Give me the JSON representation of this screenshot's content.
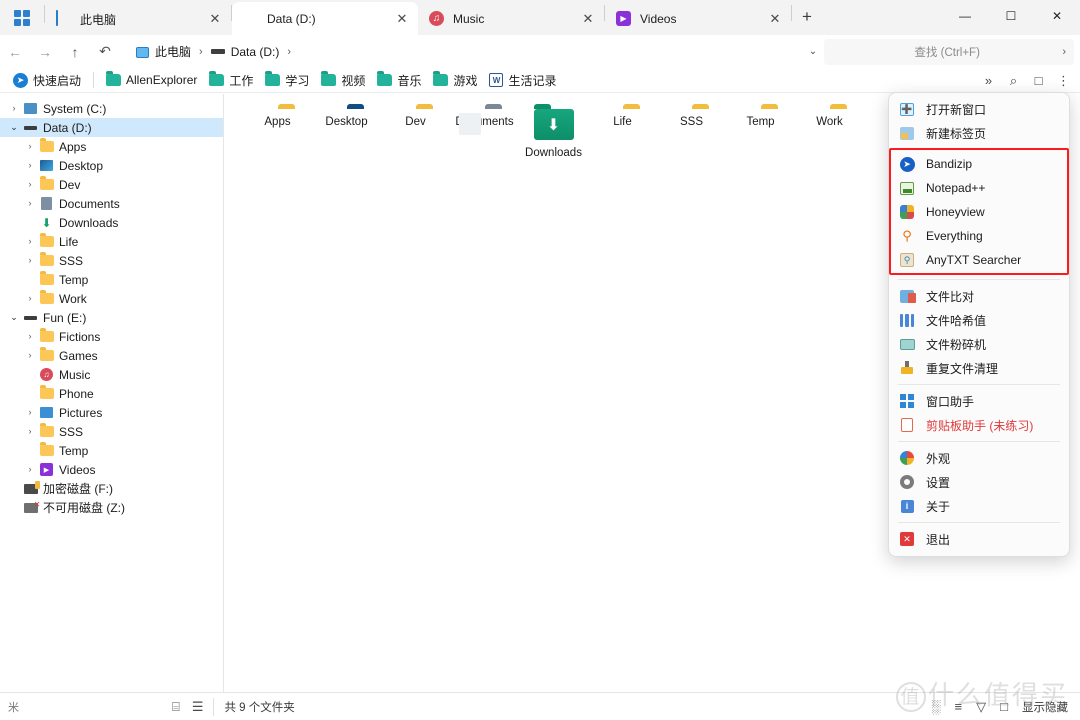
{
  "window": {
    "apps_button": "apps-grid",
    "minimize": "—",
    "maximize": "☐",
    "close": "✕",
    "new_tab": "+"
  },
  "tabs": [
    {
      "label": "此电脑",
      "icon": "monitor-icon",
      "active": false,
      "close": "✕"
    },
    {
      "label": "Data (D:)",
      "icon": "drive-icon",
      "active": true,
      "close": "✕"
    },
    {
      "label": "Music",
      "icon": "music-icon",
      "active": false,
      "close": "✕"
    },
    {
      "label": "Videos",
      "icon": "video-icon",
      "active": false,
      "close": "✕"
    }
  ],
  "addressbar": {
    "back": "←",
    "forward": "→",
    "up": "↑",
    "recent": "↶",
    "crumbs": [
      {
        "label": "此电脑",
        "icon": "monitor-icon"
      },
      {
        "label": "Data (D:)",
        "icon": "drive-icon"
      }
    ],
    "separator": "›",
    "dropdown_caret": "⌄",
    "search_placeholder": "查找 (Ctrl+F)",
    "search_value": "",
    "search_arrow": "›"
  },
  "bookmarks": {
    "quick_launch_label": "快速启动",
    "items": [
      {
        "label": "AllenExplorer",
        "icon": "folder-green-icon"
      },
      {
        "label": "工作",
        "icon": "folder-green-icon"
      },
      {
        "label": "学习",
        "icon": "folder-green-icon"
      },
      {
        "label": "视频",
        "icon": "folder-green-icon"
      },
      {
        "label": "音乐",
        "icon": "folder-green-icon"
      },
      {
        "label": "游戏",
        "icon": "folder-green-icon"
      },
      {
        "label": "生活记录",
        "icon": "word-doc-icon"
      }
    ],
    "right_buttons": [
      {
        "name": "chevrons-down-icon",
        "glyph": "»"
      },
      {
        "name": "search-icon",
        "glyph": "⌕"
      },
      {
        "name": "pane-icon",
        "glyph": "□"
      },
      {
        "name": "more-menu-icon",
        "glyph": "⋮"
      }
    ]
  },
  "sidebar": {
    "nodes": [
      {
        "label": "System (C:)",
        "indent": 0,
        "chevron": "›",
        "icon": "pc-icon",
        "selected": false
      },
      {
        "label": "Data (D:)",
        "indent": 0,
        "chevron": "⌄",
        "icon": "drive-icon",
        "selected": true
      },
      {
        "label": "Apps",
        "indent": 1,
        "chevron": "›",
        "icon": "folder-icon",
        "selected": false
      },
      {
        "label": "Desktop",
        "indent": 1,
        "chevron": "›",
        "icon": "desktop-icon",
        "selected": false
      },
      {
        "label": "Dev",
        "indent": 1,
        "chevron": "›",
        "icon": "folder-icon",
        "selected": false
      },
      {
        "label": "Documents",
        "indent": 1,
        "chevron": "›",
        "icon": "documents-icon",
        "selected": false
      },
      {
        "label": "Downloads",
        "indent": 1,
        "chevron": "",
        "icon": "downloads-icon",
        "selected": false
      },
      {
        "label": "Life",
        "indent": 1,
        "chevron": "›",
        "icon": "folder-icon",
        "selected": false
      },
      {
        "label": "SSS",
        "indent": 1,
        "chevron": "›",
        "icon": "folder-icon",
        "selected": false
      },
      {
        "label": "Temp",
        "indent": 1,
        "chevron": "",
        "icon": "folder-icon",
        "selected": false
      },
      {
        "label": "Work",
        "indent": 1,
        "chevron": "›",
        "icon": "folder-icon",
        "selected": false
      },
      {
        "label": "Fun (E:)",
        "indent": 0,
        "chevron": "⌄",
        "icon": "drive-icon",
        "selected": false
      },
      {
        "label": "Fictions",
        "indent": 1,
        "chevron": "›",
        "icon": "folder-icon",
        "selected": false
      },
      {
        "label": "Games",
        "indent": 1,
        "chevron": "›",
        "icon": "folder-icon",
        "selected": false
      },
      {
        "label": "Music",
        "indent": 1,
        "chevron": "",
        "icon": "music-icon",
        "selected": false
      },
      {
        "label": "Phone",
        "indent": 1,
        "chevron": "",
        "icon": "folder-icon",
        "selected": false
      },
      {
        "label": "Pictures",
        "indent": 1,
        "chevron": "›",
        "icon": "pictures-icon",
        "selected": false
      },
      {
        "label": "SSS",
        "indent": 1,
        "chevron": "›",
        "icon": "folder-icon",
        "selected": false
      },
      {
        "label": "Temp",
        "indent": 1,
        "chevron": "",
        "icon": "folder-icon",
        "selected": false
      },
      {
        "label": "Videos",
        "indent": 1,
        "chevron": "›",
        "icon": "videos-icon",
        "selected": false
      },
      {
        "label": "加密磁盘 (F:)",
        "indent": 0,
        "chevron": "",
        "icon": "encrypted-drive-icon",
        "selected": false
      },
      {
        "label": "不可用磁盘 (Z:)",
        "indent": 0,
        "chevron": "",
        "icon": "unavailable-drive-icon",
        "selected": false
      }
    ]
  },
  "content": {
    "items": [
      {
        "name": "Apps",
        "icon": "folder-icon"
      },
      {
        "name": "Desktop",
        "icon": "desktop-folder-icon"
      },
      {
        "name": "Dev",
        "icon": "folder-icon"
      },
      {
        "name": "Documents",
        "icon": "documents-folder-icon"
      },
      {
        "name": "Downloads",
        "icon": "downloads-folder-icon"
      },
      {
        "name": "Life",
        "icon": "folder-icon"
      },
      {
        "name": "SSS",
        "icon": "folder-icon"
      },
      {
        "name": "Temp",
        "icon": "folder-icon"
      },
      {
        "name": "Work",
        "icon": "folder-icon"
      }
    ]
  },
  "menu": {
    "highlight_color": "#fb1d1d",
    "groups": [
      {
        "items": [
          {
            "label": "打开新窗口",
            "icon": "new-window-icon",
            "red": false
          },
          {
            "label": "新建标签页",
            "icon": "new-tab-icon",
            "red": false
          }
        ]
      },
      {
        "highlighted": true,
        "items": [
          {
            "label": "Bandizip",
            "icon": "bandizip-icon",
            "red": false
          },
          {
            "label": "Notepad++",
            "icon": "notepadpp-icon",
            "red": false
          },
          {
            "label": "Honeyview",
            "icon": "honeyview-icon",
            "red": false
          },
          {
            "label": "Everything",
            "icon": "everything-icon",
            "red": false
          },
          {
            "label": "AnyTXT Searcher",
            "icon": "anytxt-icon",
            "red": false
          }
        ]
      },
      {
        "items": [
          {
            "label": "文件比对",
            "icon": "file-compare-icon",
            "red": false
          },
          {
            "label": "文件哈希值",
            "icon": "file-hash-icon",
            "red": false
          },
          {
            "label": "文件粉碎机",
            "icon": "file-shredder-icon",
            "red": false
          },
          {
            "label": "重复文件清理",
            "icon": "duplicate-cleaner-icon",
            "red": false
          }
        ]
      },
      {
        "items": [
          {
            "label": "窗口助手",
            "icon": "window-helper-icon",
            "red": false
          },
          {
            "label": "剪贴板助手 (未练习)",
            "icon": "clipboard-helper-icon",
            "red": true
          }
        ]
      },
      {
        "items": [
          {
            "label": "外观",
            "icon": "appearance-icon",
            "red": false
          },
          {
            "label": "设置",
            "icon": "settings-gear-icon",
            "red": false
          },
          {
            "label": "关于",
            "icon": "about-icon",
            "red": false
          }
        ]
      },
      {
        "items": [
          {
            "label": "退出",
            "icon": "exit-icon",
            "red": false
          }
        ]
      }
    ]
  },
  "status": {
    "left_icon": "米",
    "view_icons": [
      {
        "name": "details-view-icon",
        "glyph": "⌸"
      },
      {
        "name": "list-view-icon",
        "glyph": "☰"
      }
    ],
    "count_text": "共 9 个文件夹",
    "right_icons": [
      {
        "name": "tiles-view-icon",
        "glyph": "░"
      },
      {
        "name": "sort-icon",
        "glyph": "≡"
      },
      {
        "name": "filter-icon",
        "glyph": "▽"
      },
      {
        "name": "checkbox-icon",
        "glyph": "□"
      }
    ],
    "hidden_label": "显示隐藏"
  },
  "watermark": {
    "circle": "值",
    "text": "什么值得买"
  }
}
